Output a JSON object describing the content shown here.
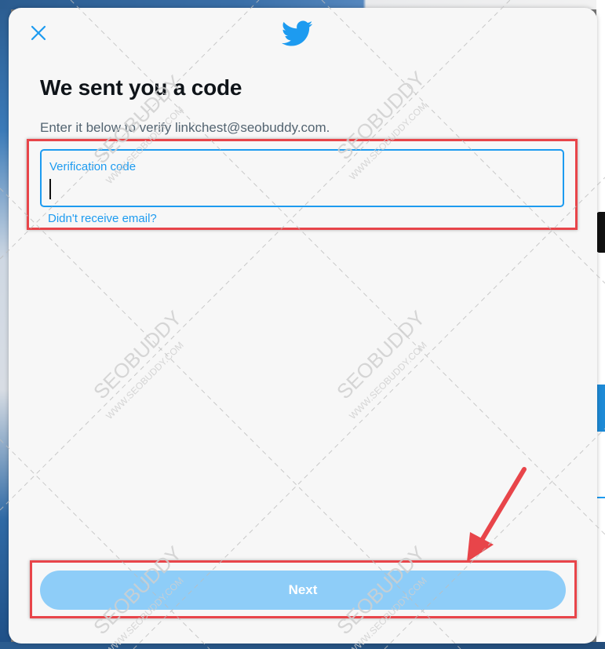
{
  "modal": {
    "title": "We sent you a code",
    "subtitle": "Enter it below to verify linkchest@seobuddy.com.",
    "close_icon": "close-icon",
    "logo_icon": "twitter-bird-icon"
  },
  "verification": {
    "label": "Verification code",
    "value": "",
    "resend_link": "Didn't receive email?"
  },
  "footer": {
    "next_label": "Next"
  },
  "watermark": {
    "brand": "SEOBUDDY",
    "url": "WWW.SEOBUDDY.COM"
  },
  "colors": {
    "accent": "#1d9bf0",
    "button_disabled": "#8ecdf8",
    "annotation": "#e8454a",
    "title": "#0f1419",
    "subtitle": "#536471"
  }
}
